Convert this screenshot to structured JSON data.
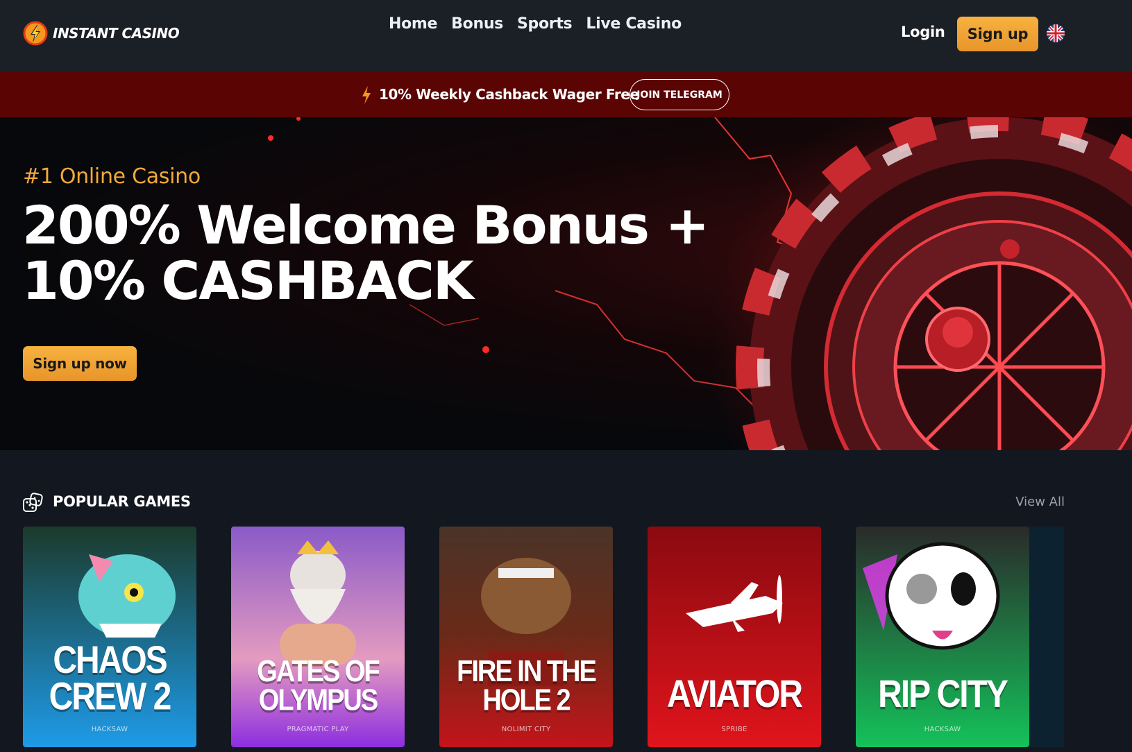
{
  "brand": {
    "name": "INSTANT CASINO",
    "accent": "#f2a93b"
  },
  "nav": {
    "items": [
      "Home",
      "Bonus",
      "Sports",
      "Live Casino"
    ]
  },
  "auth": {
    "login_label": "Login",
    "signup_label": "Sign up",
    "language_icon": "uk-flag-icon"
  },
  "promo": {
    "text": "10% Weekly Cashback Wager Free",
    "button_label": "JOIN TELEGRAM",
    "background": "#5a0404"
  },
  "hero": {
    "eyebrow": "#1 Online Casino",
    "title_line1": "200% Welcome Bonus +",
    "title_line2": "10% CASHBACK",
    "cta_label": "Sign up now"
  },
  "popular": {
    "title": "POPULAR GAMES",
    "view_all_label": "View All",
    "games": [
      {
        "name": "CHAOS CREW 2",
        "provider": "HACKSAW",
        "color_top": "#1b3a2b",
        "color_bottom": "#1e9be8"
      },
      {
        "name": "GATES OF OLYMPUS",
        "provider": "PRAGMATIC PLAY",
        "color_top": "#8a5ac8",
        "color_bottom": "#8e2ee0"
      },
      {
        "name": "FIRE IN THE HOLE 2",
        "provider": "NOLIMIT CITY",
        "color_top": "#4a3428",
        "color_bottom": "#c4141a"
      },
      {
        "name": "AVIATOR",
        "provider": "SPRIBE",
        "color_top": "#8a0a10",
        "color_bottom": "#e0141c"
      },
      {
        "name": "RIP CITY",
        "provider": "HACKSAW",
        "color_top": "#2a2a2a",
        "color_bottom": "#14c25a"
      }
    ]
  }
}
